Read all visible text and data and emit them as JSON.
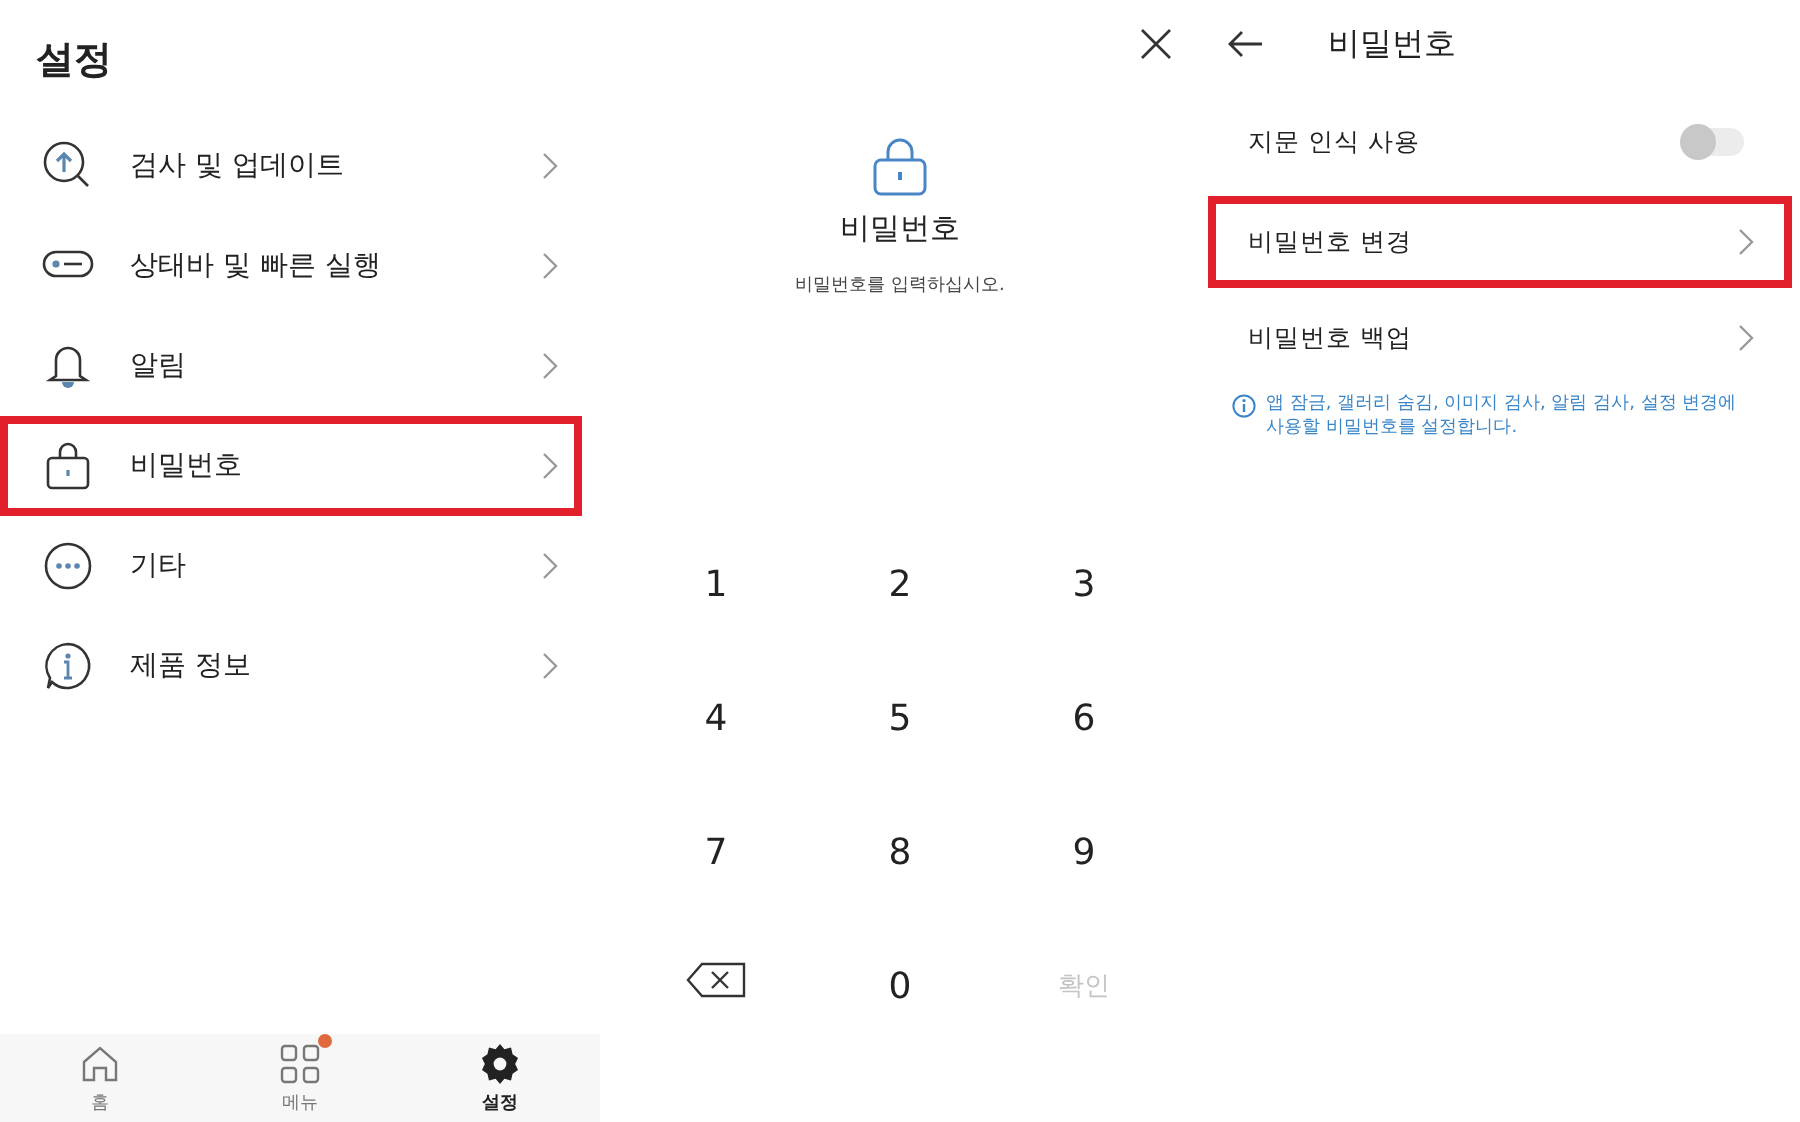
{
  "settings": {
    "title": "설정",
    "items": [
      {
        "kind": "update",
        "label": "검사 및 업데이트",
        "highlighted": false
      },
      {
        "kind": "statusbar",
        "label": "상태바 및 빠른 실행",
        "highlighted": false
      },
      {
        "kind": "bell",
        "label": "알림",
        "highlighted": false
      },
      {
        "kind": "lock",
        "label": "비밀번호",
        "highlighted": true
      },
      {
        "kind": "more",
        "label": "기타",
        "highlighted": false
      },
      {
        "kind": "info",
        "label": "제품 정보",
        "highlighted": false
      }
    ],
    "bottom_nav": [
      {
        "kind": "home",
        "label": "홈",
        "selected": false,
        "badge": false
      },
      {
        "kind": "menu",
        "label": "메뉴",
        "selected": false,
        "badge": true
      },
      {
        "kind": "gear",
        "label": "설정",
        "selected": true,
        "badge": false
      }
    ]
  },
  "password_entry": {
    "title": "비밀번호",
    "prompt": "비밀번호를 입력하십시오.",
    "keys": [
      {
        "kind": "digit",
        "label": "1"
      },
      {
        "kind": "digit",
        "label": "2"
      },
      {
        "kind": "digit",
        "label": "3"
      },
      {
        "kind": "digit",
        "label": "4"
      },
      {
        "kind": "digit",
        "label": "5"
      },
      {
        "kind": "digit",
        "label": "6"
      },
      {
        "kind": "digit",
        "label": "7"
      },
      {
        "kind": "digit",
        "label": "8"
      },
      {
        "kind": "digit",
        "label": "9"
      },
      {
        "kind": "backspace"
      },
      {
        "kind": "digit",
        "label": "0"
      },
      {
        "kind": "confirm",
        "label": "확인",
        "disabled": true
      }
    ]
  },
  "password_settings": {
    "title": "비밀번호",
    "rows": [
      {
        "kind": "toggle",
        "label": "지문 인식 사용",
        "on": false,
        "highlighted": false
      },
      {
        "kind": "link",
        "label": "비밀번호 변경",
        "highlighted": true
      },
      {
        "kind": "link",
        "label": "비밀번호 백업",
        "highlighted": false
      }
    ],
    "info": "앱 잠금, 갤러리 숨김, 이미지 검사, 알림 검사, 설정 변경에 사용할 비밀번호를 설정합니다."
  }
}
